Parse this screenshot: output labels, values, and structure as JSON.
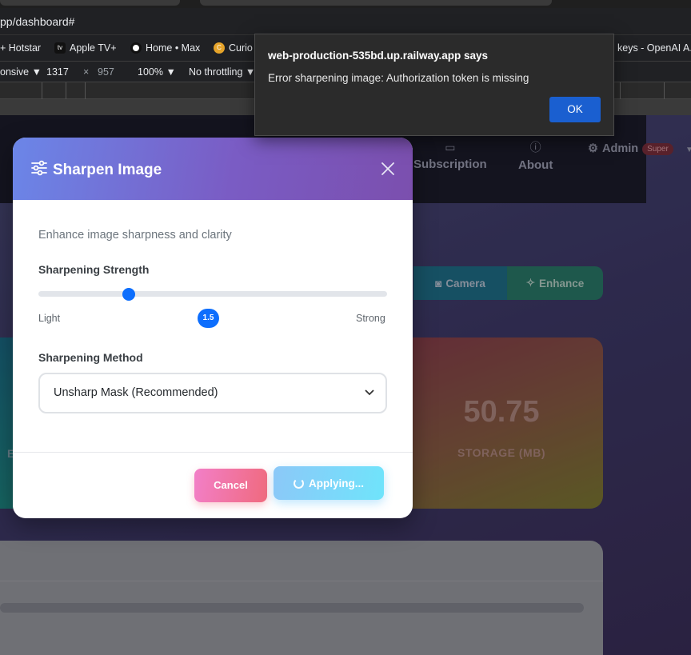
{
  "browser": {
    "url": "pp/dashboard#",
    "bookmarks": [
      {
        "label": "+ Hotstar",
        "icon": "hotstar-icon"
      },
      {
        "label": "Apple TV+",
        "icon": "apple-tv-icon"
      },
      {
        "label": "Home • Max",
        "icon": "max-icon"
      },
      {
        "label": "Curio",
        "icon": "curio-icon"
      },
      {
        "label": "keys - OpenAI A...",
        "icon": "openai-icon"
      }
    ],
    "devtools": {
      "device": "onsive",
      "width": "1317",
      "times": "×",
      "height": "957",
      "zoom": "100%",
      "throttle": "No throttling"
    }
  },
  "alert": {
    "origin": "web-production-535bd.up.railway.app says",
    "message": "Error sharpening image: Authorization token is missing",
    "ok_label": "OK"
  },
  "navbar": {
    "subscription": "Subscription",
    "about": "About",
    "admin": "Admin",
    "admin_badge": "Super"
  },
  "toolbar": {
    "camera": "Camera",
    "enhance": "Enhance"
  },
  "stats": {
    "storage_value": "50.75",
    "storage_label": "STORAGE (MB)",
    "left_card_letter": "E"
  },
  "modal": {
    "title": "Sharpen Image",
    "description": "Enhance image sharpness and clarity",
    "strength_label": "Sharpening Strength",
    "strength_value": "1.5",
    "strength_fraction": 0.26,
    "light_label": "Light",
    "strong_label": "Strong",
    "method_label": "Sharpening Method",
    "method_value": "Unsharp Mask (Recommended)",
    "cancel_label": "Cancel",
    "apply_label": "Applying..."
  },
  "colors": {
    "accent": "#0d6efd",
    "header_start": "#6b86e8",
    "header_end": "#7b4fae",
    "alert_ok": "#1a5fd0"
  }
}
